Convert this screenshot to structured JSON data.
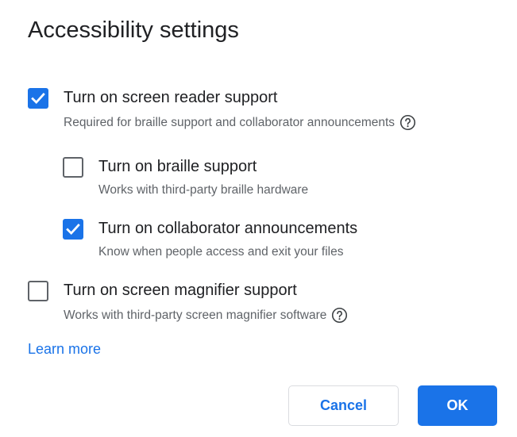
{
  "dialog": {
    "title": "Accessibility settings",
    "options": [
      {
        "label": "Turn on screen reader support",
        "description": "Required for braille support and collaborator announcements",
        "checked": true,
        "has_help": true
      },
      {
        "label": "Turn on braille support",
        "description": "Works with third-party braille hardware",
        "checked": false,
        "has_help": false
      },
      {
        "label": "Turn on collaborator announcements",
        "description": "Know when people access and exit your files",
        "checked": true,
        "has_help": false
      },
      {
        "label": "Turn on screen magnifier support",
        "description": "Works with third-party screen magnifier software",
        "checked": false,
        "has_help": true
      }
    ],
    "learn_more": "Learn more",
    "cancel_label": "Cancel",
    "ok_label": "OK"
  },
  "colors": {
    "accent": "#1a73e8",
    "text_primary": "#202124",
    "text_secondary": "#5f6368",
    "checkbox_border": "#5f6368",
    "button_border": "#dadce0"
  },
  "icons": {
    "check": "checkmark-icon",
    "help": "help-circle-icon"
  }
}
